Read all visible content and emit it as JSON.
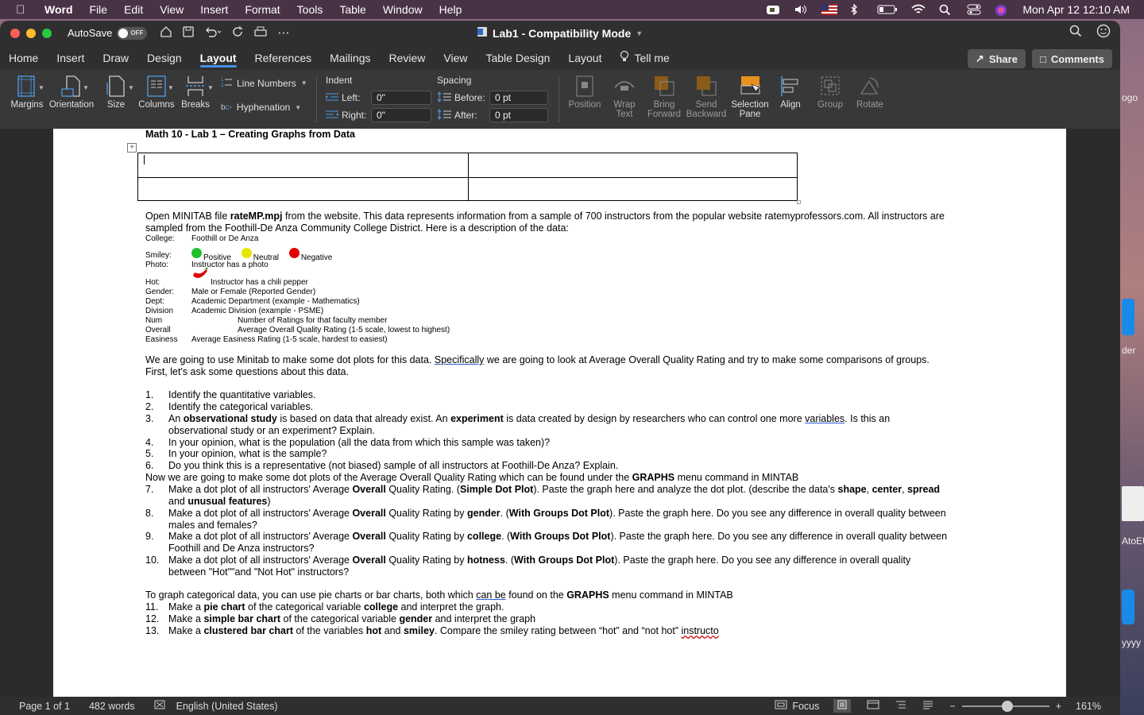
{
  "menubar": {
    "app": "Word",
    "items": [
      "File",
      "Edit",
      "View",
      "Insert",
      "Format",
      "Tools",
      "Table",
      "Window",
      "Help"
    ],
    "clock": "Mon Apr 12  12:10 AM"
  },
  "titlebar": {
    "autosave_label": "AutoSave",
    "autosave_state": "OFF",
    "doc_title": "Lab1  -  Compatibility Mode"
  },
  "tabs": {
    "items": [
      "Home",
      "Insert",
      "Draw",
      "Design",
      "Layout",
      "References",
      "Mailings",
      "Review",
      "View",
      "Table Design",
      "Layout"
    ],
    "tell_me": "Tell me",
    "share": "Share",
    "comments": "Comments"
  },
  "ribbon": {
    "margins": "Margins",
    "orientation": "Orientation",
    "size": "Size",
    "columns": "Columns",
    "breaks": "Breaks",
    "line_numbers": "Line Numbers",
    "hyphenation": "Hyphenation",
    "indent": "Indent",
    "indent_left_label": "Left:",
    "indent_left_value": "0\"",
    "indent_right_label": "Right:",
    "indent_right_value": "0\"",
    "spacing": "Spacing",
    "before_label": "Before:",
    "before_value": "0 pt",
    "after_label": "After:",
    "after_value": "0 pt",
    "position": "Position",
    "wrap_text_1": "Wrap",
    "wrap_text_2": "Text",
    "bring_forward_1": "Bring",
    "bring_forward_2": "Forward",
    "send_backward_1": "Send",
    "send_backward_2": "Backward",
    "selection_pane_1": "Selection",
    "selection_pane_2": "Pane",
    "align": "Align",
    "group": "Group",
    "rotate": "Rotate"
  },
  "doc": {
    "heading": "Math 10 - Lab 1 – Creating Graphs from Data",
    "intro_1a": "Open MINITAB file ",
    "intro_1b": "rateMP.mpj",
    "intro_1c": " from the website. This data represents information from a sample of 700 instructors from the popular website ratemyprofessors.com. All instructors are",
    "intro_2": "sampled from the Foothill-De Anza Community College District. Here is a description of the data:",
    "vars": [
      {
        "k": "College:",
        "v": "Foothill or De Anza"
      },
      {
        "k": "Smiley:",
        "v": ""
      },
      {
        "k": "Photo:",
        "v": "Instructor has a photo"
      },
      {
        "k": "Hot:",
        "v": "Instructor has a chili pepper"
      },
      {
        "k": "Gender:",
        "v": "Male or Female (Reported Gender)"
      },
      {
        "k": "Dept:",
        "v": "Academic Department (example - Mathematics)"
      },
      {
        "k": "Division",
        "v": "Academic Division (example - PSME)"
      },
      {
        "k": "Num",
        "v": "Number of Ratings for that faculty member"
      },
      {
        "k": "Overall",
        "v": "Average Overall Quality Rating (1-5 scale, lowest to highest)"
      },
      {
        "k": "Easiness",
        "v": "Average Easiness Rating (1-5 scale, hardest to easiest)"
      }
    ],
    "smiley_pos": "Positive",
    "smiley_neu": "Neutral",
    "smiley_neg": "Negative",
    "para2_a": "We are going to use Minitab to make some dot plots for this data. ",
    "para2_b": "Specifically",
    "para2_c": " we are going to look at Average Overall Quality Rating and try to make some comparisons of groups.",
    "para2_d": "First, let's ask some questions about this data.",
    "q1": "Identify the quantitative variables.",
    "q2": "Identify the categorical variables.",
    "q3a": "An ",
    "q3b": "observational study",
    "q3c": " is based on data that already exist. An ",
    "q3d": "experiment",
    "q3e": " is data created by design by researchers who can control one more ",
    "q3f": "variables",
    "q3g": ". Is this an",
    "q3h": "observational study or an experiment? Explain.",
    "q4": "In your opinion, what is the population (all the data from which this sample was taken)?",
    "q5": "In your opinion, what is the sample?",
    "q6": "Do you think this is a representative (not biased) sample of all instructors at Foothill-De Anza? Explain.",
    "now_a": "Now we are going to make some dot plots of the Average Overall Quality Rating which can be found under the ",
    "now_b": "GRAPHS",
    "now_c": " menu command in MINTAB",
    "q7": "Make a dot plot of all instructors' Average <b>Overall</b> Quality Rating. (<b>Simple Dot Plot</b>). Paste the graph here and analyze the dot plot. (describe the data's <b>shape</b>, <b>center</b>, <b>spread</b>",
    "q7b": "and <b>unusual features</b>)",
    "q8": "Make a dot plot of all instructors' Average <b>Overall</b> Quality Rating by <b>gender</b>. (<b>With Groups Dot Plot</b>). Paste the graph here. Do you see any difference in overall quality between",
    "q8b": "males and females?",
    "q9": "Make a dot plot of all instructors' Average <b>Overall</b> Quality Rating by <b>college</b>. (<b>With Groups Dot Plot</b>). Paste the graph here. Do you see any difference in overall quality between",
    "q9b": "Foothill and De Anza instructors?",
    "q10": "Make a dot plot of all instructors' Average <b>Overall</b> Quality Rating by <b>hotness</b>. (<b>With Groups Dot Plot</b>). Paste the graph here. Do you see any difference in overall quality",
    "q10b": "between \"Hot\"\"and \"Not Hot\" instructors?",
    "cat_a": "To graph categorical data, you can use pie charts or bar charts, both which ",
    "cat_b": "can  be",
    "cat_c": " found on the ",
    "cat_d": "GRAPHS",
    "cat_e": " menu command in MINTAB",
    "q11": "Make a <b>pie chart</b> of the categorical variable <b>college</b> and interpret the graph.",
    "q12": "Make a <b>simple bar chart</b> of the categorical variable <b>gender</b> and interpret the graph",
    "q13a": "Make a <b>clustered bar chart</b> of the variables <b>hot</b> and <b>smiley</b>. Compare the smiley rating between “hot” and “not hot” ",
    "q13b": "instructo"
  },
  "status": {
    "page": "Page 1 of 1",
    "words": "482 words",
    "language": "English (United States)",
    "focus": "Focus",
    "zoom": "161%"
  },
  "desktop": {
    "t1": "ogo",
    "t2": "der",
    "t3": "AtoEU",
    "t4": "yyyy"
  },
  "colors": {
    "accent": "#4a8fe7",
    "smiley_positive": "#22c02a",
    "smiley_neutral": "#e6e600",
    "smiley_negative": "#e00000"
  }
}
